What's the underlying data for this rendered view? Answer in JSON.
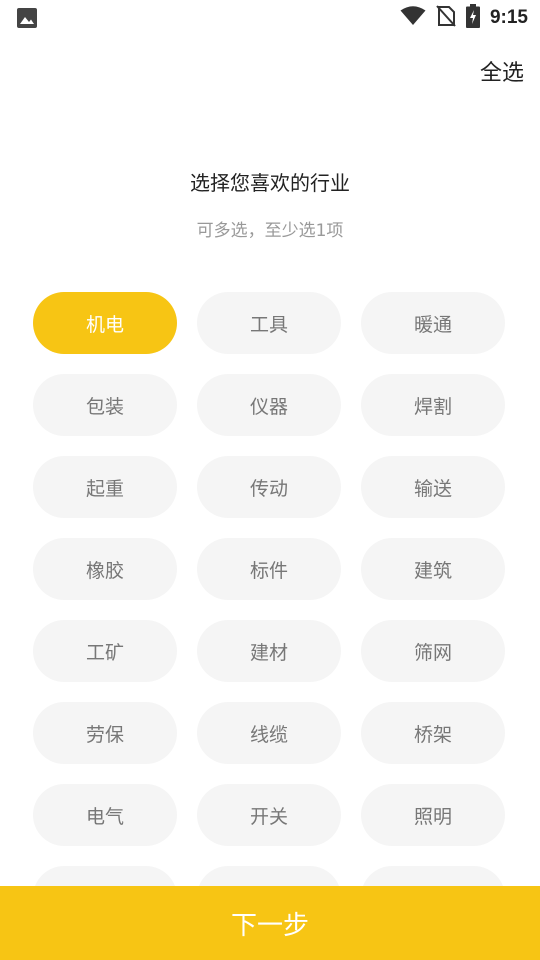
{
  "status_bar": {
    "time": "9:15",
    "icons": [
      "image-icon",
      "wifi-icon",
      "no-sim-icon",
      "battery-charging-icon"
    ]
  },
  "header": {
    "select_all_label": "全选"
  },
  "intro": {
    "title": "选择您喜欢的行业",
    "subtitle": "可多选，至少选1项"
  },
  "colors": {
    "accent": "#f7c514",
    "chip_bg": "#f5f5f5",
    "chip_text": "#777777",
    "selected_text": "#ffffff"
  },
  "industries": [
    {
      "label": "机电",
      "selected": true
    },
    {
      "label": "工具",
      "selected": false
    },
    {
      "label": "暖通",
      "selected": false
    },
    {
      "label": "包装",
      "selected": false
    },
    {
      "label": "仪器",
      "selected": false
    },
    {
      "label": "焊割",
      "selected": false
    },
    {
      "label": "起重",
      "selected": false
    },
    {
      "label": "传动",
      "selected": false
    },
    {
      "label": "输送",
      "selected": false
    },
    {
      "label": "橡胶",
      "selected": false
    },
    {
      "label": "标件",
      "selected": false
    },
    {
      "label": "建筑",
      "selected": false
    },
    {
      "label": "工矿",
      "selected": false
    },
    {
      "label": "建材",
      "selected": false
    },
    {
      "label": "筛网",
      "selected": false
    },
    {
      "label": "劳保",
      "selected": false
    },
    {
      "label": "线缆",
      "selected": false
    },
    {
      "label": "桥架",
      "selected": false
    },
    {
      "label": "电气",
      "selected": false
    },
    {
      "label": "开关",
      "selected": false
    },
    {
      "label": "照明",
      "selected": false
    },
    {
      "label": "",
      "selected": false
    },
    {
      "label": "",
      "selected": false
    },
    {
      "label": "",
      "selected": false
    }
  ],
  "footer": {
    "next_label": "下一步"
  }
}
